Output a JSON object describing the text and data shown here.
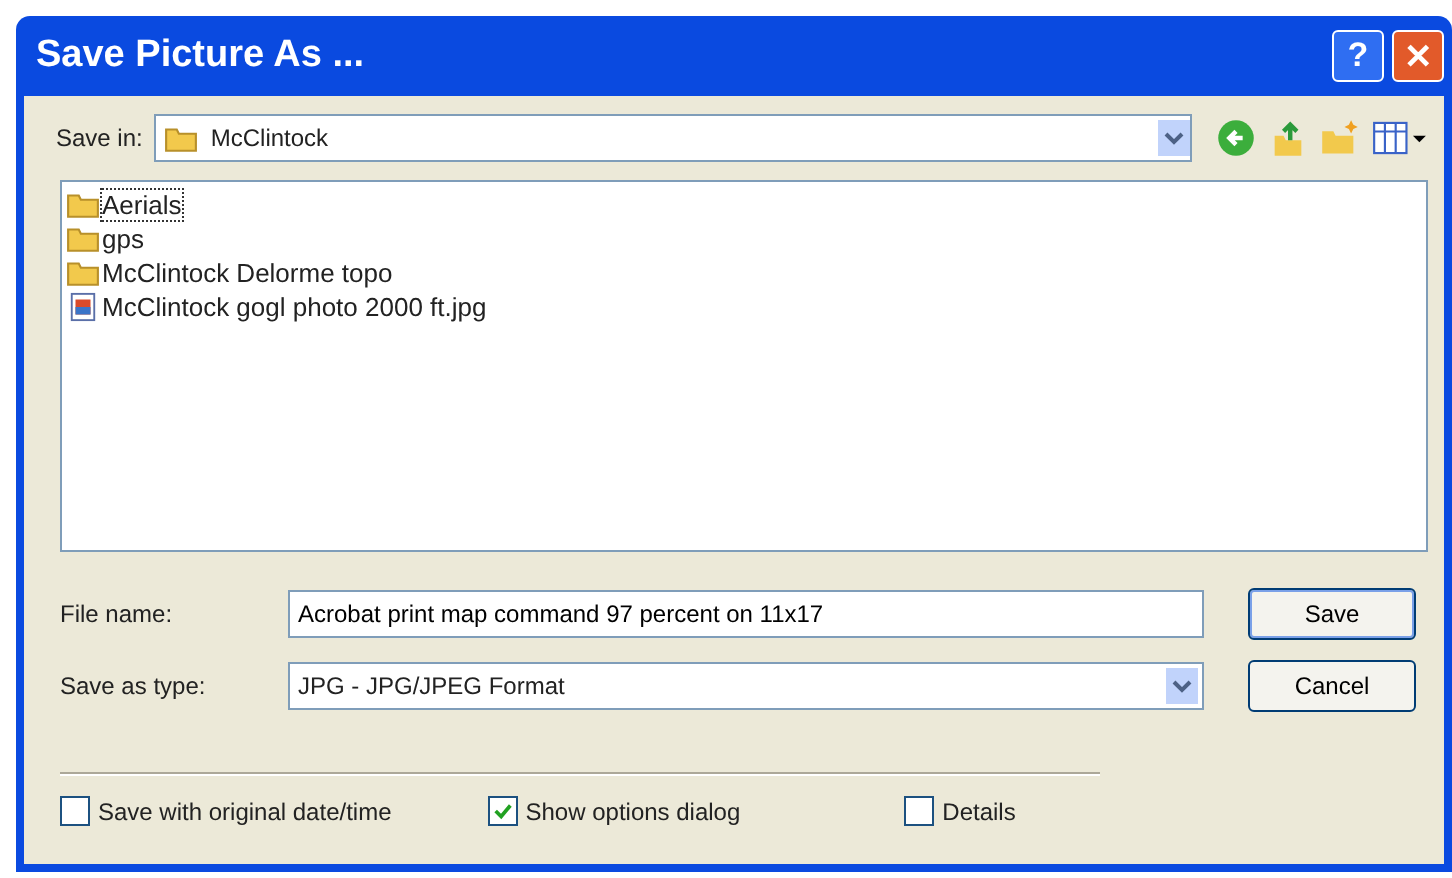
{
  "window": {
    "title": "Save Picture As ...",
    "help": "?",
    "close": "✕"
  },
  "save_in": {
    "label": "Save in:",
    "value": "McClintock"
  },
  "files": [
    {
      "name": "Aerials",
      "kind": "folder",
      "selected": true
    },
    {
      "name": "gps",
      "kind": "folder",
      "selected": false
    },
    {
      "name": "McClintock Delorme topo",
      "kind": "folder",
      "selected": false
    },
    {
      "name": "McClintock gogl photo 2000 ft.jpg",
      "kind": "image",
      "selected": false
    }
  ],
  "file_name": {
    "label": "File name:",
    "value": "Acrobat print map command 97 percent on 11x17"
  },
  "save_as_type": {
    "label": "Save as type:",
    "value": "JPG - JPG/JPEG Format"
  },
  "buttons": [
    "Save",
    "Cancel"
  ],
  "options": [
    {
      "label": "Save with original date/time",
      "checked": false
    },
    {
      "label": "Show options dialog",
      "checked": true
    },
    {
      "label": "Details",
      "checked": false
    }
  ]
}
